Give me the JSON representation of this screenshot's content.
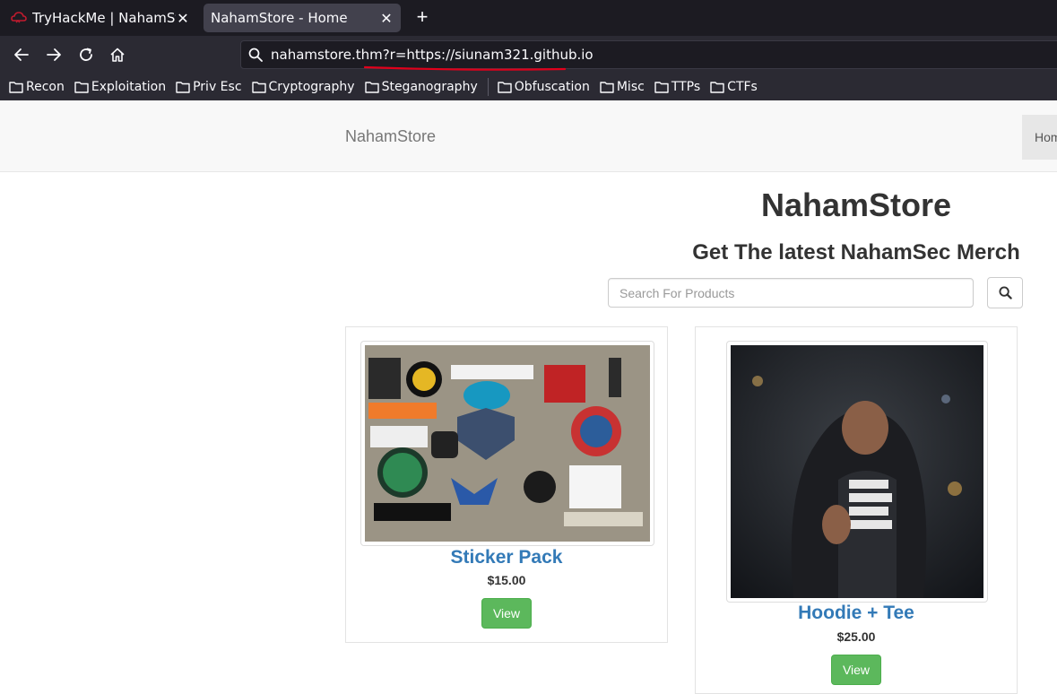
{
  "browser": {
    "tabs": [
      {
        "title": "TryHackMe | NahamStore",
        "active": false
      },
      {
        "title": "NahamStore - Home",
        "active": true
      }
    ],
    "url": "nahamstore.thm?r=https://siunam321.github.io",
    "bookmarks": [
      "Recon",
      "Exploitation",
      "Priv Esc",
      "Cryptography",
      "Steganography",
      "Obfuscation",
      "Misc",
      "TTPs",
      "CTFs"
    ],
    "icons": [
      "back-arrow-icon",
      "forward-arrow-icon",
      "reload-icon",
      "home-icon",
      "search-icon",
      "folder-icon",
      "close-icon",
      "plus-icon"
    ],
    "colors": {
      "chrome_dark": "#1c1b22",
      "chrome": "#2b2a33",
      "active_tab": "#42414d",
      "annotation": "#e0001b"
    }
  },
  "site": {
    "brand": "NahamStore",
    "nav_home": "Home",
    "title": "NahamStore",
    "subtitle": "Get The latest NahamSec Merch",
    "search_placeholder": "Search For Products",
    "products": [
      {
        "name": "Sticker Pack",
        "price": "$15.00",
        "button": "View"
      },
      {
        "name": "Hoodie + Tee",
        "price": "$25.00",
        "button": "View"
      }
    ],
    "colors": {
      "link": "#337ab7",
      "success": "#5cb85c"
    }
  }
}
